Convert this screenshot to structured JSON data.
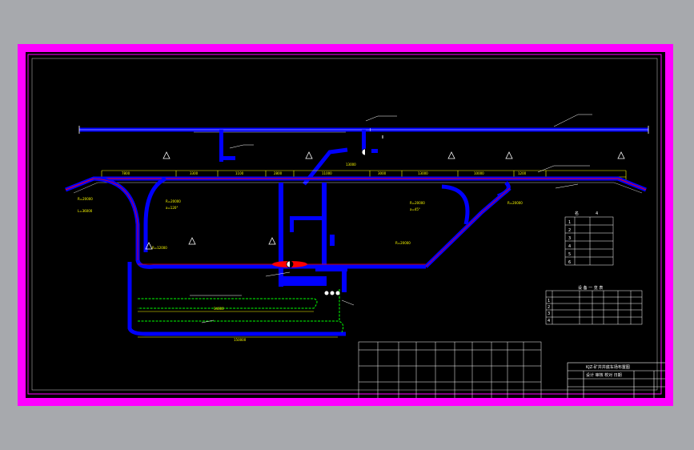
{
  "colors": {
    "frame": "#ff00ff",
    "sheet": "#000000",
    "track": "#0000ff",
    "centerline": "#ff0000",
    "dimension": "#ffff00",
    "conveyor": "#00ff00",
    "text": "#ffffff"
  },
  "icons": {
    "signal": "triangle-signal-icon",
    "turnout": "half-filled-circle-icon",
    "note": "leader-line-icon"
  },
  "legend": {
    "rows": [
      "1",
      "2",
      "3",
      "4",
      "5",
      "6"
    ],
    "header_short": [
      "名",
      "4"
    ]
  },
  "equipment_table": {
    "caption": "设 备 一 览 表",
    "row_nums": [
      "1",
      "2",
      "3",
      "4"
    ]
  },
  "title_block": {
    "title": "KJZ-矿井井底车场布置图",
    "subtitle": "设计 审核 校对 日期"
  }
}
